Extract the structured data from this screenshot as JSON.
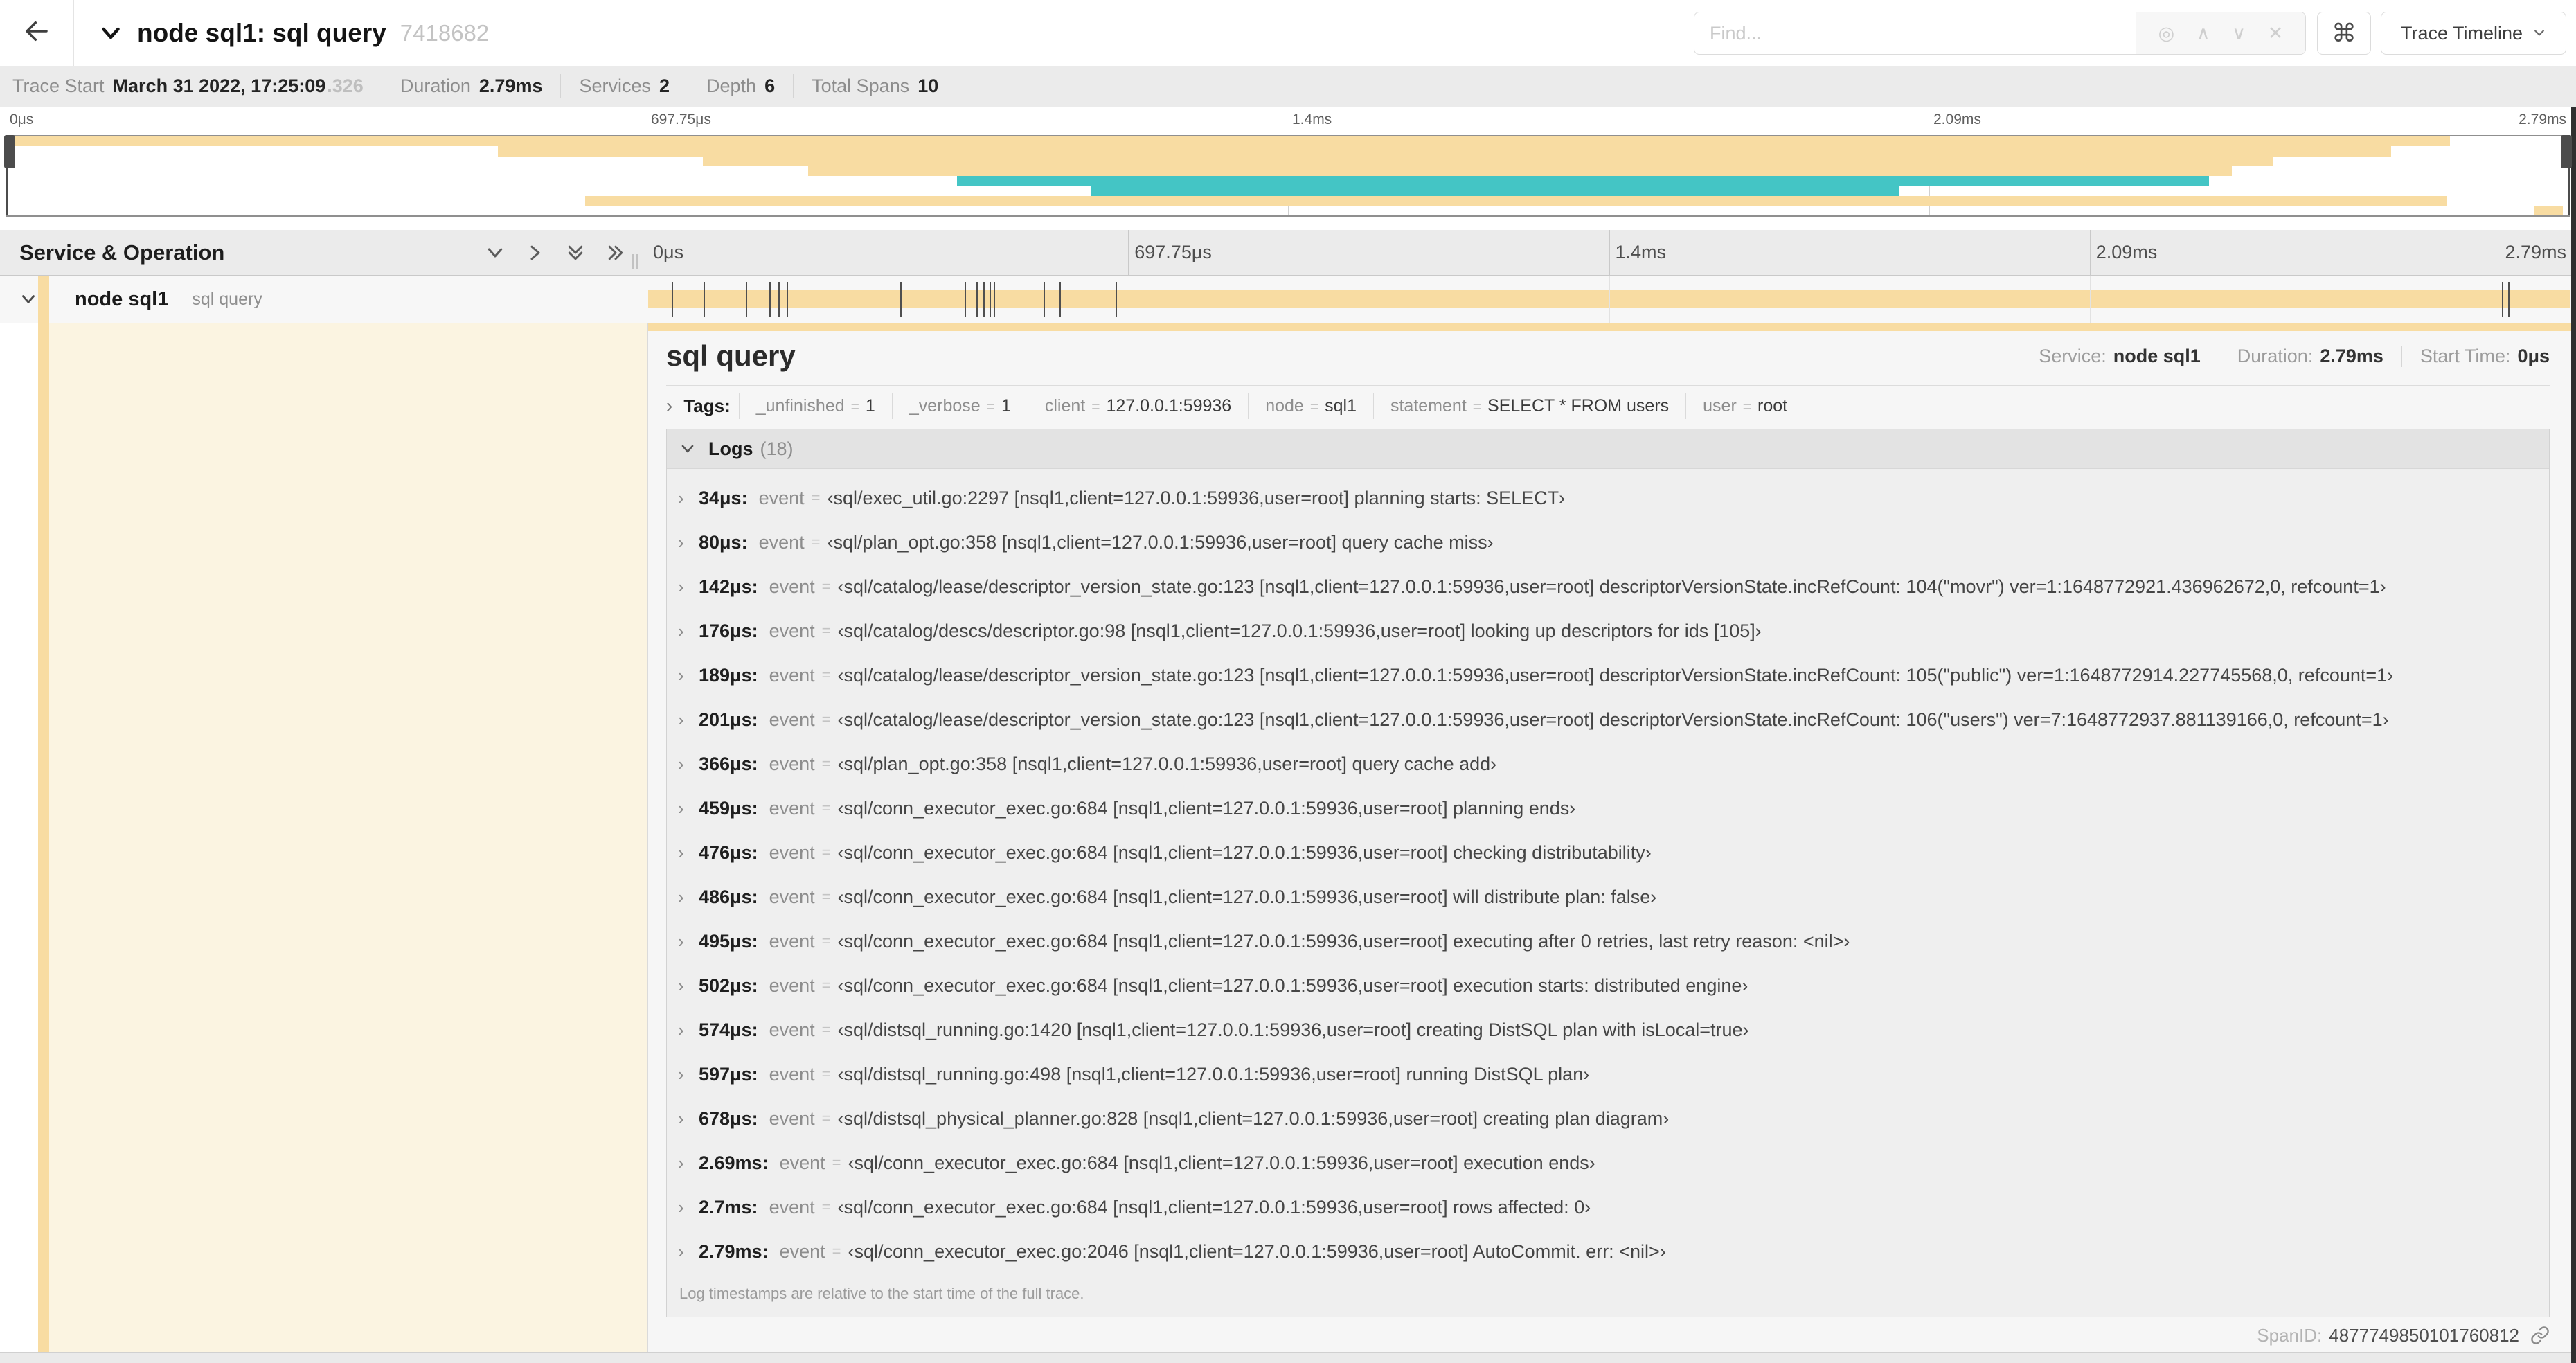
{
  "colors": {
    "span_tan": "#F8DCA2",
    "span_teal": "#44C5C5",
    "ivory": "#FBF4E1"
  },
  "header": {
    "back_icon": "arrow-left",
    "title": "node sql1: sql query",
    "trace_id_short": "7418682",
    "find_placeholder": "Find...",
    "find_addon_icons": [
      {
        "name": "locate-icon",
        "glyph": "◎"
      },
      {
        "name": "chevron-up-icon",
        "glyph": "∧"
      },
      {
        "name": "chevron-down-icon",
        "glyph": "∨"
      },
      {
        "name": "clear-icon",
        "glyph": "✕"
      }
    ],
    "shortcuts_glyph": "⌘",
    "view_select_label": "Trace Timeline"
  },
  "trace_bar": {
    "items": [
      {
        "label": "Trace Start",
        "value": "March 31 2022, 17:25:09",
        "suffix": ".326"
      },
      {
        "label": "Duration",
        "value": "2.79ms"
      },
      {
        "label": "Services",
        "value": "2"
      },
      {
        "label": "Depth",
        "value": "6"
      },
      {
        "label": "Total Spans",
        "value": "10"
      }
    ]
  },
  "timeline": {
    "ticks": [
      {
        "label": "0μs",
        "pos": 0
      },
      {
        "label": "697.75μs",
        "pos": 0.25
      },
      {
        "label": "1.4ms",
        "pos": 0.5
      },
      {
        "label": "2.09ms",
        "pos": 0.75
      },
      {
        "label": "2.79ms",
        "pos": 1
      }
    ],
    "gridline_positions": [
      0.25,
      0.5,
      0.75
    ],
    "left_title": "Service & Operation"
  },
  "minimap": {
    "rows": [
      {
        "s": 0.0,
        "e": 0.953,
        "c": "span_tan"
      },
      {
        "s": 0.192,
        "e": 0.93,
        "c": "span_tan"
      },
      {
        "s": 0.272,
        "e": 0.884,
        "c": "span_tan"
      },
      {
        "s": 0.313,
        "e": 0.868,
        "c": "span_tan"
      },
      {
        "s": 0.371,
        "e": 0.859,
        "c": "span_teal"
      },
      {
        "s": 0.423,
        "e": 0.738,
        "c": "span_teal"
      },
      {
        "s": 0.226,
        "e": 0.952,
        "c": "span_tan"
      },
      {
        "s": 0.986,
        "e": 0.997,
        "c": "span_tan"
      }
    ]
  },
  "span_row": {
    "service": "node sql1",
    "operation": "sql query",
    "total_us": 2790,
    "tick_times_us": [
      34,
      80,
      142,
      176,
      189,
      201,
      366,
      459,
      476,
      486,
      495,
      502,
      574,
      597,
      678,
      2690,
      2700
    ]
  },
  "detail": {
    "title": "sql query",
    "meta": [
      {
        "label": "Service:",
        "value": "node sql1"
      },
      {
        "label": "Duration:",
        "value": "2.79ms"
      },
      {
        "label": "Start Time:",
        "value": "0μs"
      }
    ],
    "tags_chevron": "›",
    "tags_label": "Tags:",
    "eq": "=",
    "tags": [
      {
        "k": "_unfinished",
        "v": "1"
      },
      {
        "k": "_verbose",
        "v": "1"
      },
      {
        "k": "client",
        "v": "127.0.0.1:59936"
      },
      {
        "k": "node",
        "v": "sql1"
      },
      {
        "k": "statement",
        "v": "SELECT * FROM users"
      },
      {
        "k": "user",
        "v": "root"
      }
    ],
    "logs_label": "Logs",
    "logs_count": "(18)",
    "event_label": "event",
    "row_chevron": "›",
    "logs": [
      {
        "t": "34μs:",
        "m": "‹sql/exec_util.go:2297 [nsql1,client=127.0.0.1:59936,user=root] planning starts: SELECT›"
      },
      {
        "t": "80μs:",
        "m": "‹sql/plan_opt.go:358 [nsql1,client=127.0.0.1:59936,user=root] query cache miss›"
      },
      {
        "t": "142μs:",
        "m": "‹sql/catalog/lease/descriptor_version_state.go:123 [nsql1,client=127.0.0.1:59936,user=root] descriptorVersionState.incRefCount: 104(\"movr\") ver=1:1648772921.436962672,0, refcount=1›"
      },
      {
        "t": "176μs:",
        "m": "‹sql/catalog/descs/descriptor.go:98 [nsql1,client=127.0.0.1:59936,user=root] looking up descriptors for ids [105]›"
      },
      {
        "t": "189μs:",
        "m": "‹sql/catalog/lease/descriptor_version_state.go:123 [nsql1,client=127.0.0.1:59936,user=root] descriptorVersionState.incRefCount: 105(\"public\") ver=1:1648772914.227745568,0, refcount=1›"
      },
      {
        "t": "201μs:",
        "m": "‹sql/catalog/lease/descriptor_version_state.go:123 [nsql1,client=127.0.0.1:59936,user=root] descriptorVersionState.incRefCount: 106(\"users\") ver=7:1648772937.881139166,0, refcount=1›"
      },
      {
        "t": "366μs:",
        "m": "‹sql/plan_opt.go:358 [nsql1,client=127.0.0.1:59936,user=root] query cache add›"
      },
      {
        "t": "459μs:",
        "m": "‹sql/conn_executor_exec.go:684 [nsql1,client=127.0.0.1:59936,user=root] planning ends›"
      },
      {
        "t": "476μs:",
        "m": "‹sql/conn_executor_exec.go:684 [nsql1,client=127.0.0.1:59936,user=root] checking distributability›"
      },
      {
        "t": "486μs:",
        "m": "‹sql/conn_executor_exec.go:684 [nsql1,client=127.0.0.1:59936,user=root] will distribute plan: false›"
      },
      {
        "t": "495μs:",
        "m": "‹sql/conn_executor_exec.go:684 [nsql1,client=127.0.0.1:59936,user=root] executing after 0 retries, last retry reason: <nil>›"
      },
      {
        "t": "502μs:",
        "m": "‹sql/conn_executor_exec.go:684 [nsql1,client=127.0.0.1:59936,user=root] execution starts: distributed engine›"
      },
      {
        "t": "574μs:",
        "m": "‹sql/distsql_running.go:1420 [nsql1,client=127.0.0.1:59936,user=root] creating DistSQL plan with isLocal=true›"
      },
      {
        "t": "597μs:",
        "m": "‹sql/distsql_running.go:498 [nsql1,client=127.0.0.1:59936,user=root] running DistSQL plan›"
      },
      {
        "t": "678μs:",
        "m": "‹sql/distsql_physical_planner.go:828 [nsql1,client=127.0.0.1:59936,user=root] creating plan diagram›"
      },
      {
        "t": "2.69ms:",
        "m": "‹sql/conn_executor_exec.go:684 [nsql1,client=127.0.0.1:59936,user=root] execution ends›"
      },
      {
        "t": "2.7ms:",
        "m": "‹sql/conn_executor_exec.go:684 [nsql1,client=127.0.0.1:59936,user=root] rows affected: 0›"
      },
      {
        "t": "2.79ms:",
        "m": "‹sql/conn_executor_exec.go:2046 [nsql1,client=127.0.0.1:59936,user=root] AutoCommit. err: <nil>›"
      }
    ],
    "footnote": "Log timestamps are relative to the start time of the full trace.",
    "spanid_label": "SpanID:",
    "spanid": "4877749850101760812"
  }
}
